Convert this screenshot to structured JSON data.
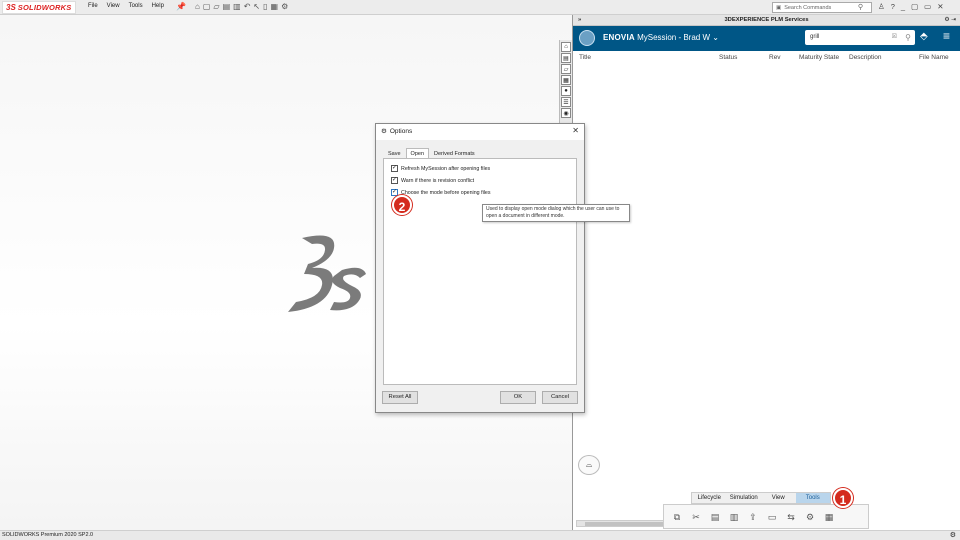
{
  "app": {
    "logo_mark": "3S",
    "logo_text": "SOLIDWORKS",
    "status_bar": "SOLIDWORKS Premium 2020 SP2.0"
  },
  "menubar": {
    "items": [
      "File",
      "View",
      "Tools",
      "Help"
    ],
    "search_placeholder": "Search Commands",
    "right_icons": [
      "user-icon",
      "help-icon",
      "minimize-icon",
      "maximize-icon",
      "close-icon"
    ]
  },
  "panel": {
    "title": "3DEXPERIENCE PLM Services",
    "enovia_brand": "ENOVIA",
    "enovia_session": "MySession - Brad W",
    "search_value": "grill",
    "columns": [
      "Title",
      "Status",
      "Rev",
      "Maturity State",
      "Description",
      "File Name"
    ],
    "tabs": [
      {
        "label": "Lifecycle",
        "active": false
      },
      {
        "label": "Simulation",
        "active": false
      },
      {
        "label": "View",
        "active": false
      },
      {
        "label": "Tools",
        "active": true
      }
    ]
  },
  "dialog": {
    "title": "Options",
    "tabs": [
      {
        "label": "Save",
        "active": false
      },
      {
        "label": "Open",
        "active": true
      },
      {
        "label": "Derived Formats",
        "active": false
      }
    ],
    "options": [
      {
        "label": "Refresh MySession after opening files",
        "checked": true
      },
      {
        "label": "Warn if there is revision conflict",
        "checked": true
      },
      {
        "label": "Choose the mode before opening files",
        "checked": true
      }
    ],
    "tooltip": "Used to display open mode dialog which the user can use to open a document in different mode.",
    "reset_label": "Reset All",
    "ok_label": "OK",
    "cancel_label": "Cancel"
  },
  "badges": {
    "first": "1",
    "second": "2"
  },
  "colors": {
    "enovia_bar": "#005686",
    "badge": "#d42b1e",
    "active_tab": "#b9d5ec"
  }
}
